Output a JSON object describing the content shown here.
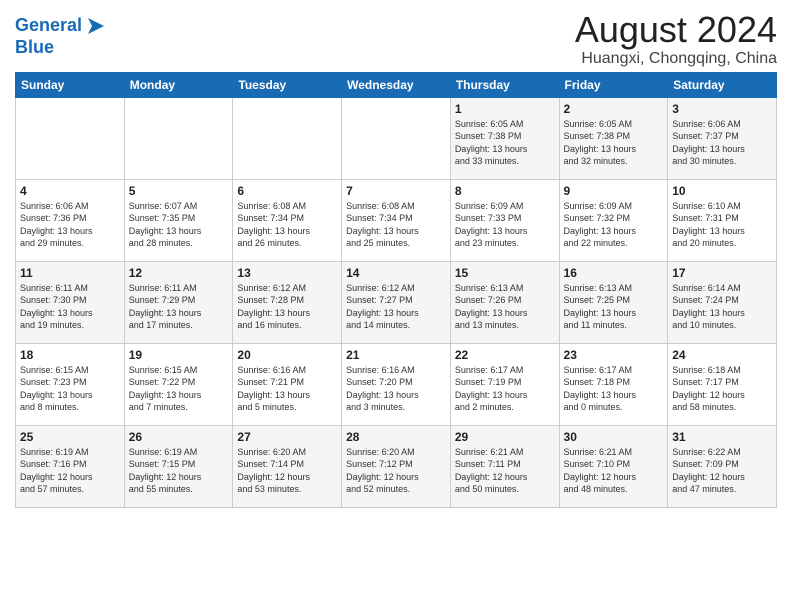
{
  "logo": {
    "line1": "General",
    "line2": "Blue"
  },
  "header": {
    "month": "August 2024",
    "location": "Huangxi, Chongqing, China"
  },
  "weekdays": [
    "Sunday",
    "Monday",
    "Tuesday",
    "Wednesday",
    "Thursday",
    "Friday",
    "Saturday"
  ],
  "weeks": [
    [
      {
        "day": "",
        "detail": ""
      },
      {
        "day": "",
        "detail": ""
      },
      {
        "day": "",
        "detail": ""
      },
      {
        "day": "",
        "detail": ""
      },
      {
        "day": "1",
        "detail": "Sunrise: 6:05 AM\nSunset: 7:38 PM\nDaylight: 13 hours\nand 33 minutes."
      },
      {
        "day": "2",
        "detail": "Sunrise: 6:05 AM\nSunset: 7:38 PM\nDaylight: 13 hours\nand 32 minutes."
      },
      {
        "day": "3",
        "detail": "Sunrise: 6:06 AM\nSunset: 7:37 PM\nDaylight: 13 hours\nand 30 minutes."
      }
    ],
    [
      {
        "day": "4",
        "detail": "Sunrise: 6:06 AM\nSunset: 7:36 PM\nDaylight: 13 hours\nand 29 minutes."
      },
      {
        "day": "5",
        "detail": "Sunrise: 6:07 AM\nSunset: 7:35 PM\nDaylight: 13 hours\nand 28 minutes."
      },
      {
        "day": "6",
        "detail": "Sunrise: 6:08 AM\nSunset: 7:34 PM\nDaylight: 13 hours\nand 26 minutes."
      },
      {
        "day": "7",
        "detail": "Sunrise: 6:08 AM\nSunset: 7:34 PM\nDaylight: 13 hours\nand 25 minutes."
      },
      {
        "day": "8",
        "detail": "Sunrise: 6:09 AM\nSunset: 7:33 PM\nDaylight: 13 hours\nand 23 minutes."
      },
      {
        "day": "9",
        "detail": "Sunrise: 6:09 AM\nSunset: 7:32 PM\nDaylight: 13 hours\nand 22 minutes."
      },
      {
        "day": "10",
        "detail": "Sunrise: 6:10 AM\nSunset: 7:31 PM\nDaylight: 13 hours\nand 20 minutes."
      }
    ],
    [
      {
        "day": "11",
        "detail": "Sunrise: 6:11 AM\nSunset: 7:30 PM\nDaylight: 13 hours\nand 19 minutes."
      },
      {
        "day": "12",
        "detail": "Sunrise: 6:11 AM\nSunset: 7:29 PM\nDaylight: 13 hours\nand 17 minutes."
      },
      {
        "day": "13",
        "detail": "Sunrise: 6:12 AM\nSunset: 7:28 PM\nDaylight: 13 hours\nand 16 minutes."
      },
      {
        "day": "14",
        "detail": "Sunrise: 6:12 AM\nSunset: 7:27 PM\nDaylight: 13 hours\nand 14 minutes."
      },
      {
        "day": "15",
        "detail": "Sunrise: 6:13 AM\nSunset: 7:26 PM\nDaylight: 13 hours\nand 13 minutes."
      },
      {
        "day": "16",
        "detail": "Sunrise: 6:13 AM\nSunset: 7:25 PM\nDaylight: 13 hours\nand 11 minutes."
      },
      {
        "day": "17",
        "detail": "Sunrise: 6:14 AM\nSunset: 7:24 PM\nDaylight: 13 hours\nand 10 minutes."
      }
    ],
    [
      {
        "day": "18",
        "detail": "Sunrise: 6:15 AM\nSunset: 7:23 PM\nDaylight: 13 hours\nand 8 minutes."
      },
      {
        "day": "19",
        "detail": "Sunrise: 6:15 AM\nSunset: 7:22 PM\nDaylight: 13 hours\nand 7 minutes."
      },
      {
        "day": "20",
        "detail": "Sunrise: 6:16 AM\nSunset: 7:21 PM\nDaylight: 13 hours\nand 5 minutes."
      },
      {
        "day": "21",
        "detail": "Sunrise: 6:16 AM\nSunset: 7:20 PM\nDaylight: 13 hours\nand 3 minutes."
      },
      {
        "day": "22",
        "detail": "Sunrise: 6:17 AM\nSunset: 7:19 PM\nDaylight: 13 hours\nand 2 minutes."
      },
      {
        "day": "23",
        "detail": "Sunrise: 6:17 AM\nSunset: 7:18 PM\nDaylight: 13 hours\nand 0 minutes."
      },
      {
        "day": "24",
        "detail": "Sunrise: 6:18 AM\nSunset: 7:17 PM\nDaylight: 12 hours\nand 58 minutes."
      }
    ],
    [
      {
        "day": "25",
        "detail": "Sunrise: 6:19 AM\nSunset: 7:16 PM\nDaylight: 12 hours\nand 57 minutes."
      },
      {
        "day": "26",
        "detail": "Sunrise: 6:19 AM\nSunset: 7:15 PM\nDaylight: 12 hours\nand 55 minutes."
      },
      {
        "day": "27",
        "detail": "Sunrise: 6:20 AM\nSunset: 7:14 PM\nDaylight: 12 hours\nand 53 minutes."
      },
      {
        "day": "28",
        "detail": "Sunrise: 6:20 AM\nSunset: 7:12 PM\nDaylight: 12 hours\nand 52 minutes."
      },
      {
        "day": "29",
        "detail": "Sunrise: 6:21 AM\nSunset: 7:11 PM\nDaylight: 12 hours\nand 50 minutes."
      },
      {
        "day": "30",
        "detail": "Sunrise: 6:21 AM\nSunset: 7:10 PM\nDaylight: 12 hours\nand 48 minutes."
      },
      {
        "day": "31",
        "detail": "Sunrise: 6:22 AM\nSunset: 7:09 PM\nDaylight: 12 hours\nand 47 minutes."
      }
    ]
  ]
}
